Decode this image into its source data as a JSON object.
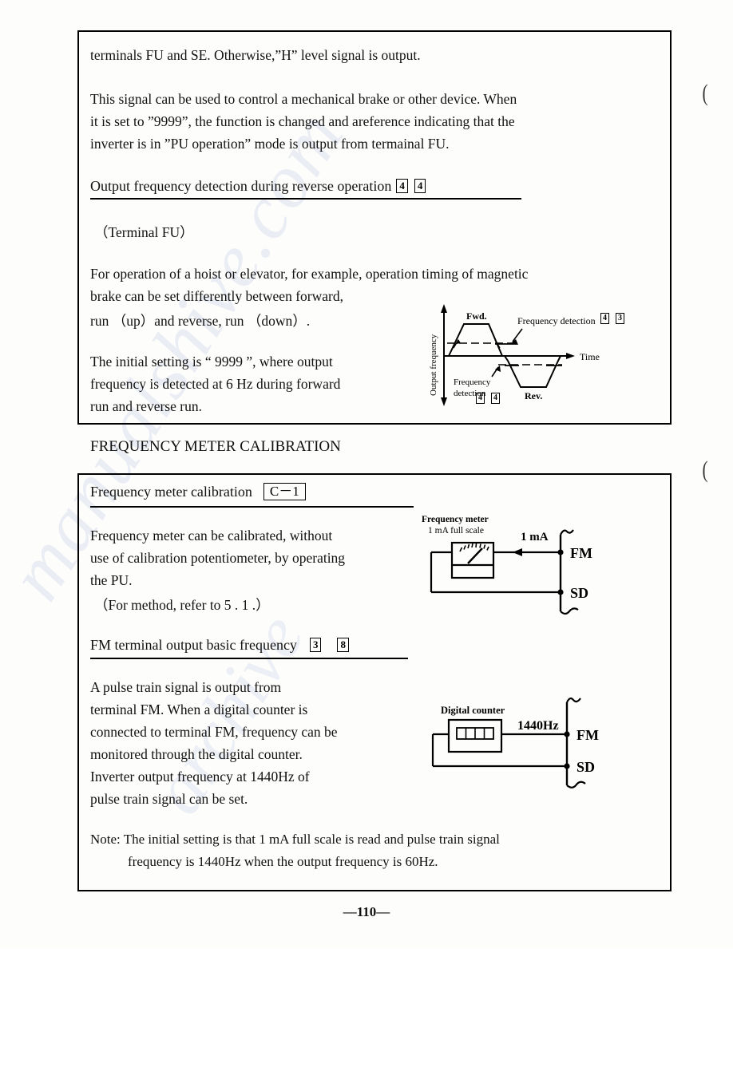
{
  "page": {
    "number": "—110—",
    "margin_marks": [
      "(",
      "("
    ]
  },
  "section_1": {
    "paragraph_1": "terminals  FU  and  SE.  Otherwise,”H”  level  signal  is  output.",
    "paragraph_2_lines": [
      "This  signal  can  be  used  to  control  a  mechanical  brake  or  other  device.  When",
      "it  is  set  to  ”9999”, the  function  is  changed  and  areference  indicating  that  the",
      "inverter  is  in  ”PU  operation”  mode  is  output  from  termainal  FU."
    ],
    "subheading": "Output   frequency   detection   during   reverse   operation",
    "subheading_refs": [
      "4",
      "4"
    ],
    "terminal_note": "（Terminal   FU）",
    "body_lines_left": [
      "For  operation  of  a  hoist  or  elevator, for  example, operation  timing  of  magnetic",
      "brake  can  be  set  differently  between  forward,",
      "run （up）and  reverse, run （down）."
    ],
    "body_lines_left2": [
      "The  initial  setting  is  “ 9999 ”, where  output",
      "frequency  is  detected  at  6 Hz  during  forward",
      "run  and  reverse  run."
    ],
    "waveform_diagram": {
      "y_axis_label": "Output   frequency",
      "x_axis_label": "Time",
      "forward_label": "Fwd.",
      "reverse_label": "Rev.",
      "annotation_top": "Frequency   detection",
      "annotation_top_refs": [
        "4",
        "3"
      ],
      "annotation_bottom_line1": "Frequency",
      "annotation_bottom_line2": "detection",
      "annotation_bottom_refs": [
        "4",
        "4"
      ]
    }
  },
  "section_title": "FREQUENCY   METER   CALIBRATION",
  "section_2": {
    "block_a": {
      "heading": "Frequency   meter   calibration",
      "code": "C－1",
      "body_lines": [
        "Frequency  meter  can  be  calibrated, without",
        "use  of  calibration  potentiometer, by  operating",
        "the  PU."
      ],
      "body_extra": "（For   method, refer   to   5 . 1 .）",
      "diagram": {
        "caption_line1": "Frequency   meter",
        "caption_line2": "1 mA   full   scale",
        "current_label": "1 mA",
        "terminal_fm": "FM",
        "terminal_sd": "SD"
      }
    },
    "block_b": {
      "heading": "FM   terminal   output   basic   frequency",
      "heading_refs": [
        "3",
        "8"
      ],
      "body_lines": [
        "A  pulse  train  signal  is  output  from",
        "terminal  FM.  When  a  digital  counter  is",
        "connected  to  terminal  FM, frequency  can  be",
        "monitored  through  the  digital  counter.",
        "Inverter  output  frequency  at  1440Hz  of",
        "pulse  train  signal  can  be  set."
      ],
      "diagram": {
        "caption": "Digital   counter",
        "frequency_label": "1440Hz",
        "terminal_fm": "FM",
        "terminal_sd": "SD"
      }
    },
    "note_line1": "Note: The   initial   setting   is   that   1 mA   full   scale   is   read   and   pulse   train   signal",
    "note_line2": "frequency   is   1440Hz   when   the   output   frequency   is   60Hz."
  }
}
